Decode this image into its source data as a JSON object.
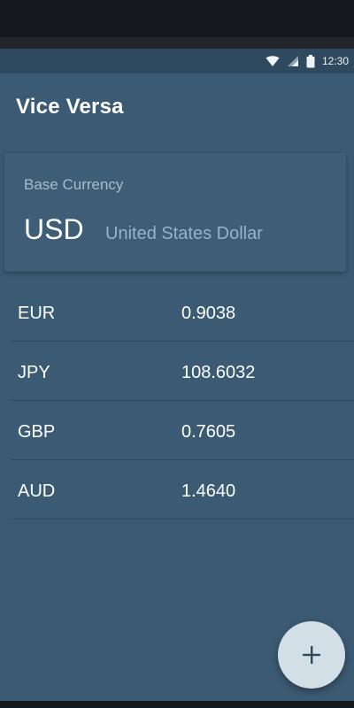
{
  "status_bar": {
    "time": "12:30",
    "icons": [
      "wifi-icon",
      "signal-icon",
      "battery-icon"
    ]
  },
  "app": {
    "title": "Vice Versa"
  },
  "base_currency": {
    "label": "Base Currency",
    "code": "USD",
    "name": "United States Dollar"
  },
  "rates": [
    {
      "code": "EUR",
      "value": "0.9038"
    },
    {
      "code": "JPY",
      "value": "108.6032"
    },
    {
      "code": "GBP",
      "value": "0.7605"
    },
    {
      "code": "AUD",
      "value": "1.4640"
    }
  ],
  "fab": {
    "icon": "plus-icon"
  },
  "colors": {
    "primary": "#3b5a73",
    "status_bar": "#2f4a5f",
    "card": "#3e5d76",
    "fab": "#d3dfe6",
    "fab_icon": "#2f4a5f"
  }
}
